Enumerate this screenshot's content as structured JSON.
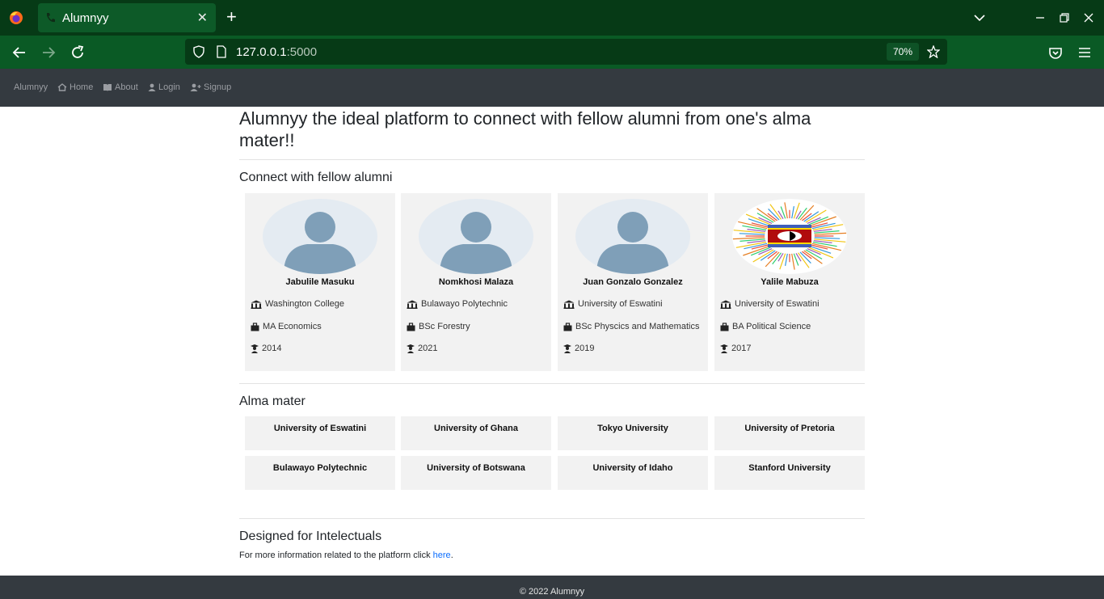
{
  "browser": {
    "tab_title": "Alumnyy",
    "url_host": "127.0.0.1",
    "url_port": ":5000",
    "zoom": "70%"
  },
  "site_nav": {
    "brand": "Alumnyy",
    "links": [
      "Home",
      "About",
      "Login",
      "Signup"
    ]
  },
  "hero": {
    "title": "Alumnyy the ideal platform to connect with fellow alumni from one's alma mater!!"
  },
  "connect": {
    "heading": "Connect with fellow alumni",
    "alumni": [
      {
        "name": "Jabulile Masuku",
        "school": "Washington College",
        "degree": "MA Economics",
        "year": "2014",
        "avatar": "default-avatar"
      },
      {
        "name": "Nomkhosi Malaza",
        "school": "Bulawayo Polytechnic",
        "degree": "BSc Forestry",
        "year": "2021",
        "avatar": "default-avatar"
      },
      {
        "name": "Juan Gonzalo Gonzalez",
        "school": "University of Eswatini",
        "degree": "BSc Physcics and Mathematics",
        "year": "2019",
        "avatar": "default-avatar"
      },
      {
        "name": "Yalile Mabuza",
        "school": "University of Eswatini",
        "degree": "BA Political Science",
        "year": "2017",
        "avatar": "eswatini-flag-image"
      }
    ]
  },
  "alma_mater": {
    "heading": "Alma mater",
    "schools": [
      "University of Eswatini",
      "University of Ghana",
      "Tokyo University",
      "University of Pretoria",
      "Bulawayo Polytechnic",
      "University of Botswana",
      "University of Idaho",
      "Stanford University"
    ]
  },
  "designed": {
    "heading": "Designed for Intelectuals",
    "text": "For more information related to the platform click ",
    "link_text": "here",
    "suffix": "."
  },
  "footer": {
    "text": "© 2022 Alumnyy"
  },
  "colors": {
    "tabbar": "#063a16",
    "toolbar": "#0a5a25",
    "site_nav": "#343a40",
    "card_bg": "#f2f2f2",
    "avatar_fill": "#7f9fb8",
    "link": "#0d6efd"
  }
}
